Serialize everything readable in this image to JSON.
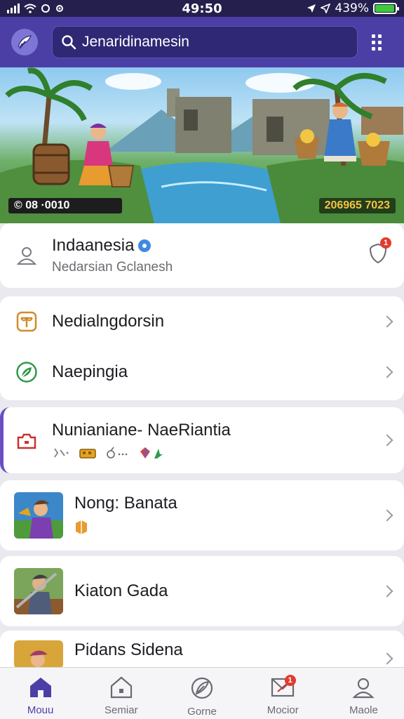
{
  "status_bar": {
    "time": "49:50",
    "battery_text": "439%",
    "battery_level": 0.95
  },
  "header": {
    "search_value": "Jenaridinamesin"
  },
  "banner": {
    "counter_left": "© 08  ·0010",
    "counter_right": "206965 7023"
  },
  "profile": {
    "title": "Indaanesia",
    "subtitle": "Nedarsian Gclanesh",
    "notification_count": "1"
  },
  "menu": {
    "items": [
      {
        "label": "Nedialngdorsin"
      },
      {
        "label": "Naepingia"
      }
    ]
  },
  "featured": {
    "title": "Nunianiane- NaeRiantia"
  },
  "games": [
    {
      "title": "Nong: Banata"
    },
    {
      "title": "Kiaton Gada"
    },
    {
      "title": "Pidans Sidena"
    }
  ],
  "tabs": [
    {
      "label": "Mouu",
      "active": true
    },
    {
      "label": "Semiar"
    },
    {
      "label": "Gorne"
    },
    {
      "label": "Mocior",
      "badge": "1"
    },
    {
      "label": "Maole"
    }
  ],
  "colors": {
    "accent": "#4b3fa6",
    "header": "#4b3fa6",
    "status_bar": "#241f4d",
    "badge": "#e23b2e"
  }
}
